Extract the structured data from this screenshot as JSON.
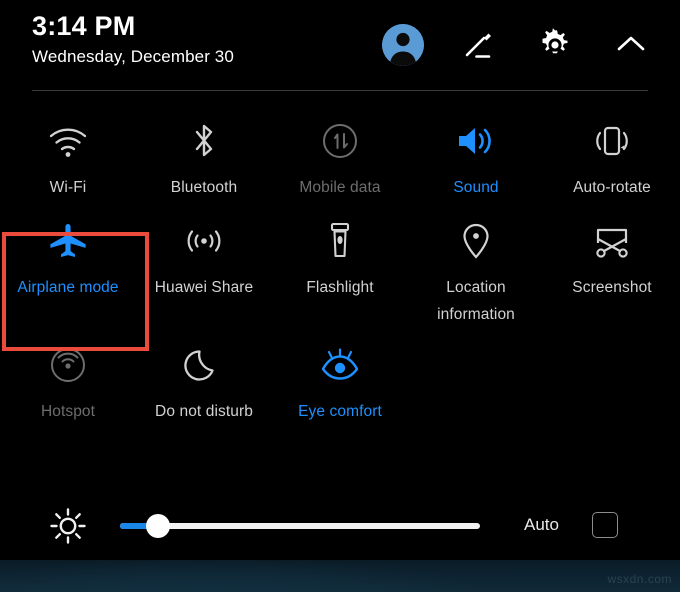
{
  "colors": {
    "background": "#000000",
    "accent_active": "#1e90ff",
    "label_default": "#d2d2d2",
    "label_disabled": "#6d6d6d",
    "highlight_box": "#ea4b3c",
    "slider_fill": "#1a86e8",
    "slider_track": "#f2f2f2",
    "avatar_background": "#5b9bd5"
  },
  "header": {
    "time": "3:14 PM",
    "date": "Wednesday, December 30",
    "actions": [
      {
        "name": "avatar",
        "icon": "user-avatar-icon"
      },
      {
        "name": "edit",
        "icon": "pencil-edit-icon"
      },
      {
        "name": "settings",
        "icon": "gear-icon"
      },
      {
        "name": "collapse",
        "icon": "chevron-up-icon"
      }
    ]
  },
  "tiles": {
    "rows": [
      [
        {
          "label": "Wi-Fi",
          "icon": "wifi-icon",
          "state": "inactive"
        },
        {
          "label": "Bluetooth",
          "icon": "bluetooth-icon",
          "state": "inactive"
        },
        {
          "label": "Mobile data",
          "icon": "mobile-data-icon",
          "state": "disabled"
        },
        {
          "label": "Sound",
          "icon": "sound-icon",
          "state": "active"
        },
        {
          "label": "Auto-rotate",
          "icon": "auto-rotate-icon",
          "state": "inactive"
        }
      ],
      [
        {
          "label": "Airplane mode",
          "icon": "airplane-icon",
          "state": "active"
        },
        {
          "label": "Huawei Share",
          "icon": "huawei-share-icon",
          "state": "inactive"
        },
        {
          "label": "Flashlight",
          "icon": "flashlight-icon",
          "state": "inactive"
        },
        {
          "label": "Location information",
          "icon": "location-pin-icon",
          "state": "inactive"
        },
        {
          "label": "Screenshot",
          "icon": "screenshot-scissors-icon",
          "state": "inactive"
        }
      ],
      [
        {
          "label": "Hotspot",
          "icon": "hotspot-icon",
          "state": "disabled"
        },
        {
          "label": "Do not disturb",
          "icon": "moon-icon",
          "state": "inactive"
        },
        {
          "label": "Eye comfort",
          "icon": "eye-comfort-icon",
          "state": "active"
        },
        {
          "label": "",
          "icon": "",
          "state": "empty"
        },
        {
          "label": "",
          "icon": "",
          "state": "empty"
        }
      ]
    ]
  },
  "brightness": {
    "icon": "brightness-sun-icon",
    "value_percent": 11,
    "auto_label": "Auto",
    "auto_checked": false
  },
  "watermark": {
    "text": "wsxdn.com"
  }
}
